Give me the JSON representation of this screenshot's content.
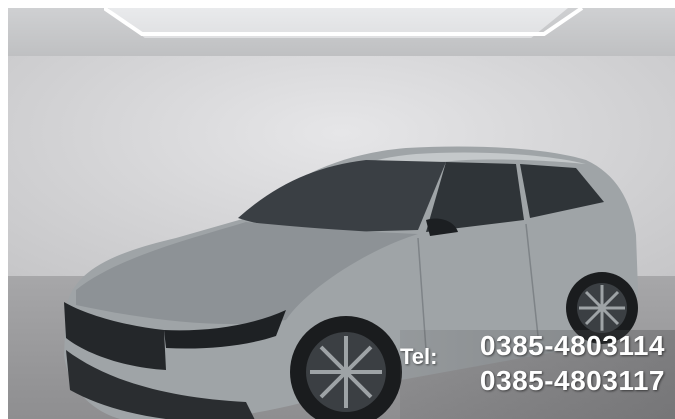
{
  "contact": {
    "tel_label": "Tel:",
    "phone_1": "0385-4803114",
    "phone_2": "0385-4803117"
  },
  "colors": {
    "car_body": "#9ea3a6",
    "wall": "#d8d8da",
    "floor": "#9b9b9d",
    "text": "#ffffff"
  }
}
